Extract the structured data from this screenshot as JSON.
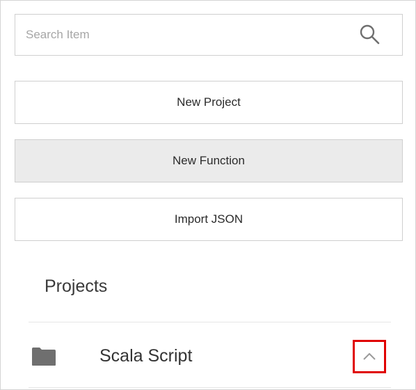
{
  "search": {
    "placeholder": "Search Item",
    "value": "",
    "icon": "search-icon"
  },
  "actions": {
    "new_project_label": "New Project",
    "new_function_label": "New Function",
    "import_json_label": "Import JSON"
  },
  "projects": {
    "title": "Projects",
    "items": [
      {
        "label": "Scala Script",
        "icon": "folder-icon",
        "toggle_icon": "chevron-up-icon",
        "expanded": true
      }
    ]
  },
  "colors": {
    "border": "#cfcfcf",
    "active_button_bg": "#ebebeb",
    "highlight": "#e00000",
    "icon_gray": "#6f6f6f"
  }
}
